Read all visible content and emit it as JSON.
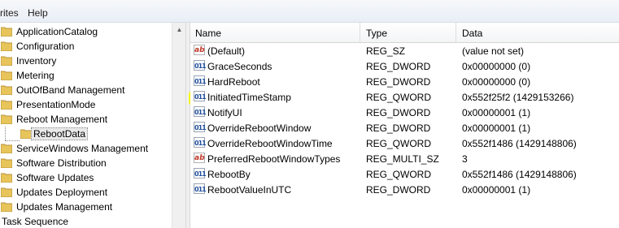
{
  "menubar": {
    "items": [
      "rites",
      "Help"
    ]
  },
  "tree": {
    "items": [
      {
        "label": "ApplicationCatalog"
      },
      {
        "label": "Configuration"
      },
      {
        "label": "Inventory"
      },
      {
        "label": "Metering"
      },
      {
        "label": "OutOfBand Management"
      },
      {
        "label": "PresentationMode"
      },
      {
        "label": "Reboot Management"
      },
      {
        "label": "RebootData"
      },
      {
        "label": "ServiceWindows Management"
      },
      {
        "label": "Software Distribution"
      },
      {
        "label": "Software Updates"
      },
      {
        "label": "Updates Deployment"
      },
      {
        "label": "Updates Management"
      },
      {
        "label": "Task Sequence"
      }
    ]
  },
  "list": {
    "columns": {
      "name": "Name",
      "type": "Type",
      "data": "Data"
    },
    "rows": [
      {
        "name": "(Default)",
        "type": "REG_SZ",
        "data": "(value not set)",
        "icon": "string-value-icon",
        "glyph": "ab"
      },
      {
        "name": "GraceSeconds",
        "type": "REG_DWORD",
        "data": "0x00000000 (0)",
        "icon": "binary-value-icon",
        "glyph": "011"
      },
      {
        "name": "HardReboot",
        "type": "REG_DWORD",
        "data": "0x00000000 (0)",
        "icon": "binary-value-icon",
        "glyph": "011"
      },
      {
        "name": "InitiatedTimeStamp",
        "type": "REG_QWORD",
        "data": "0x552f25f2 (1429153266)",
        "icon": "binary-value-icon",
        "glyph": "011"
      },
      {
        "name": "NotifyUI",
        "type": "REG_DWORD",
        "data": "0x00000001 (1)",
        "icon": "binary-value-icon",
        "glyph": "011"
      },
      {
        "name": "OverrideRebootWindow",
        "type": "REG_DWORD",
        "data": "0x00000001 (1)",
        "icon": "binary-value-icon",
        "glyph": "011"
      },
      {
        "name": "OverrideRebootWindowTime",
        "type": "REG_QWORD",
        "data": "0x552f1486 (1429148806)",
        "icon": "binary-value-icon",
        "glyph": "011"
      },
      {
        "name": "PreferredRebootWindowTypes",
        "type": "REG_MULTI_SZ",
        "data": "3",
        "icon": "string-value-icon",
        "glyph": "ab"
      },
      {
        "name": "RebootBy",
        "type": "REG_QWORD",
        "data": "0x552f1486 (1429148806)",
        "icon": "binary-value-icon",
        "glyph": "011"
      },
      {
        "name": "RebootValueInUTC",
        "type": "REG_DWORD",
        "data": "0x00000001 (1)",
        "icon": "binary-value-icon",
        "glyph": "011"
      }
    ]
  },
  "colors": {
    "highlight": "#f7f500",
    "folder": "#e8c55a"
  }
}
